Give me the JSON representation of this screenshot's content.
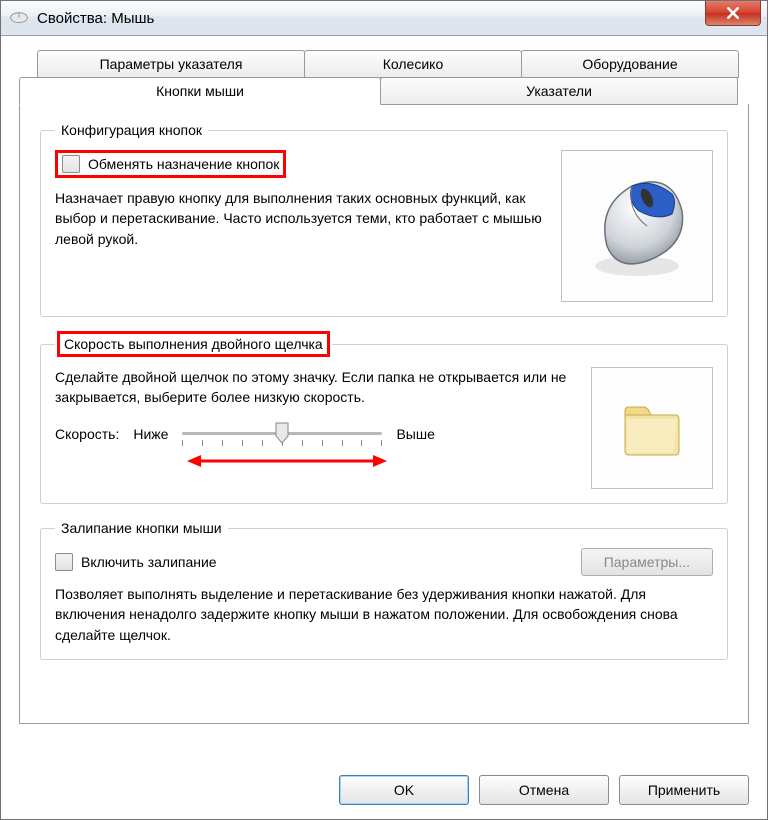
{
  "window": {
    "title": "Свойства: Мышь"
  },
  "tabs": {
    "top": [
      {
        "label": "Параметры указателя"
      },
      {
        "label": "Колесико"
      },
      {
        "label": "Оборудование"
      }
    ],
    "bottom": [
      {
        "label": "Кнопки мыши",
        "active": true
      },
      {
        "label": "Указатели"
      }
    ]
  },
  "group_buttons": {
    "legend": "Конфигурация кнопок",
    "swap_label": "Обменять назначение кнопок",
    "swap_desc": "Назначает правую кнопку для выполнения таких основных функций, как выбор и перетаскивание. Часто используется теми, кто работает с мышью левой рукой."
  },
  "group_doubleclick": {
    "legend": "Скорость выполнения двойного щелчка",
    "desc": "Сделайте двойной щелчок по этому значку. Если папка не открывается или не закрывается, выберите более низкую скорость.",
    "speed_label": "Скорость:",
    "slow_label": "Ниже",
    "fast_label": "Выше"
  },
  "group_clicklock": {
    "legend": "Залипание кнопки мыши",
    "enable_label": "Включить залипание",
    "params_button": "Параметры...",
    "desc": "Позволяет выполнять выделение и перетаскивание без удерживания кнопки нажатой. Для включения ненадолго задержите кнопку мыши в нажатом положении. Для освобождения снова сделайте щелчок."
  },
  "buttons": {
    "ok": "OK",
    "cancel": "Отмена",
    "apply": "Применить"
  }
}
